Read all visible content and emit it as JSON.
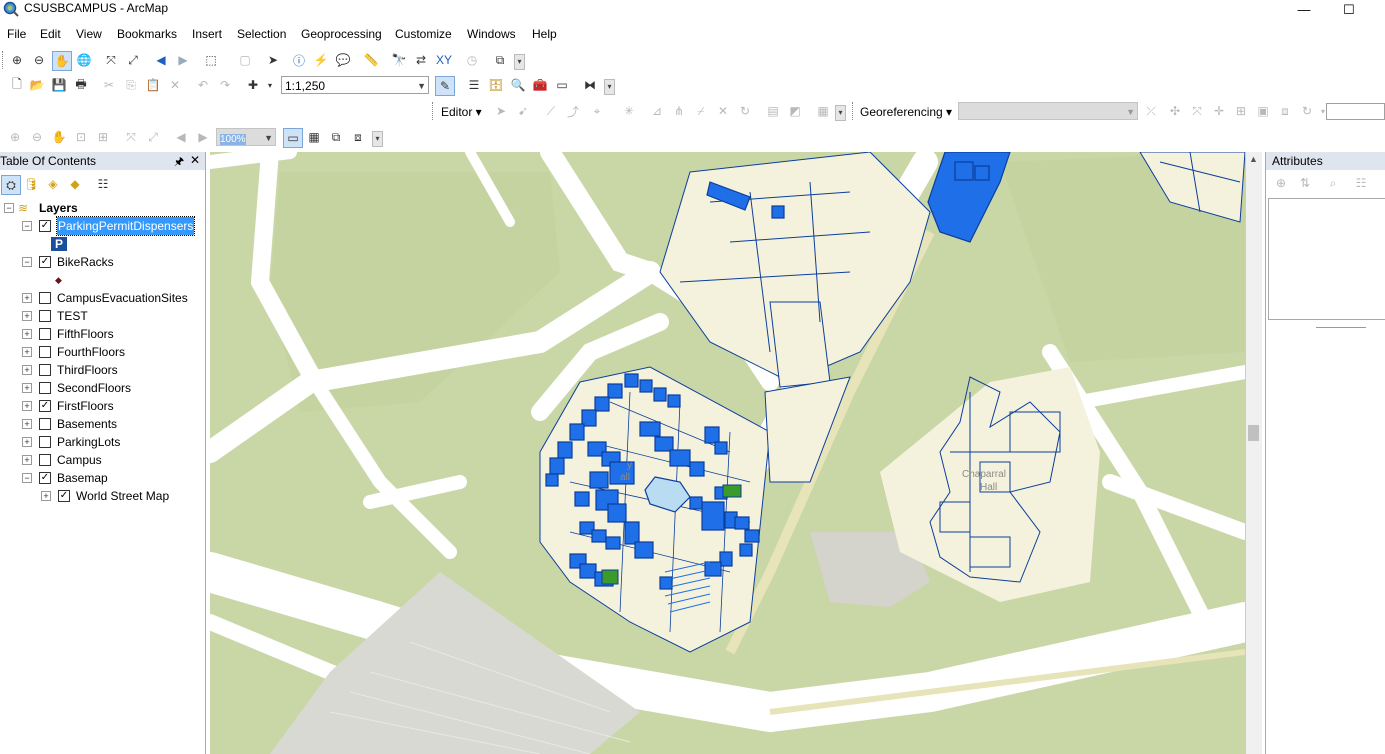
{
  "window": {
    "title": "CSUSBCAMPUS - ArcMap",
    "minimize_glyph": "—",
    "maximize_glyph": "☐"
  },
  "menu": [
    "File",
    "Edit",
    "View",
    "Bookmarks",
    "Insert",
    "Selection",
    "Geoprocessing",
    "Customize",
    "Windows",
    "Help"
  ],
  "standard_toolbar": {
    "scale_value": "1:1,250"
  },
  "editor_toolbar": {
    "editor_label": "Editor ▾"
  },
  "georef_toolbar": {
    "label": "Georeferencing ▾",
    "layer_combo_value": ""
  },
  "tools_toolbar": {
    "zoom_combo_value": "100%"
  },
  "toc": {
    "title": "Table Of Contents",
    "pin_glyph": "🖈",
    "close_glyph": "✕",
    "root_label": "Layers",
    "layers": [
      {
        "label": "ParkingPermitDispensers",
        "checked": true,
        "expanded": true,
        "selected": true,
        "symbol": "P"
      },
      {
        "label": "BikeRacks",
        "checked": true,
        "expanded": true,
        "selected": false,
        "symbol": "◆"
      },
      {
        "label": "CampusEvacuationSites",
        "checked": false,
        "expanded": false
      },
      {
        "label": "TEST",
        "checked": false,
        "expanded": false
      },
      {
        "label": "FifthFloors",
        "checked": false,
        "expanded": false
      },
      {
        "label": "FourthFloors",
        "checked": false,
        "expanded": false
      },
      {
        "label": "ThirdFloors",
        "checked": false,
        "expanded": false
      },
      {
        "label": "SecondFloors",
        "checked": false,
        "expanded": false
      },
      {
        "label": "FirstFloors",
        "checked": true,
        "expanded": false
      },
      {
        "label": "Basements",
        "checked": false,
        "expanded": false
      },
      {
        "label": "ParkingLots",
        "checked": false,
        "expanded": false
      },
      {
        "label": "Campus",
        "checked": false,
        "expanded": false
      },
      {
        "label": "Basemap",
        "checked": true,
        "expanded": true
      },
      {
        "label": "World Street Map",
        "checked": true,
        "expanded": false,
        "child": true
      }
    ]
  },
  "map_labels": {
    "hall_left_1": "y",
    "hall_left_2": "all",
    "hall_right_1": "Chaparral",
    "hall_right_2": "Hall"
  },
  "attributes": {
    "title": "Attributes"
  },
  "colors": {
    "background_panel": "#f0f0f0",
    "selection": "#3399ff",
    "map_grass": "#c9d6a6",
    "map_road": "#ffffff",
    "building_fill": "#1f6fe8",
    "building_outline": "#0b3e9c",
    "building_base": "#f4f2dc",
    "green_room": "#3a9a2a"
  }
}
